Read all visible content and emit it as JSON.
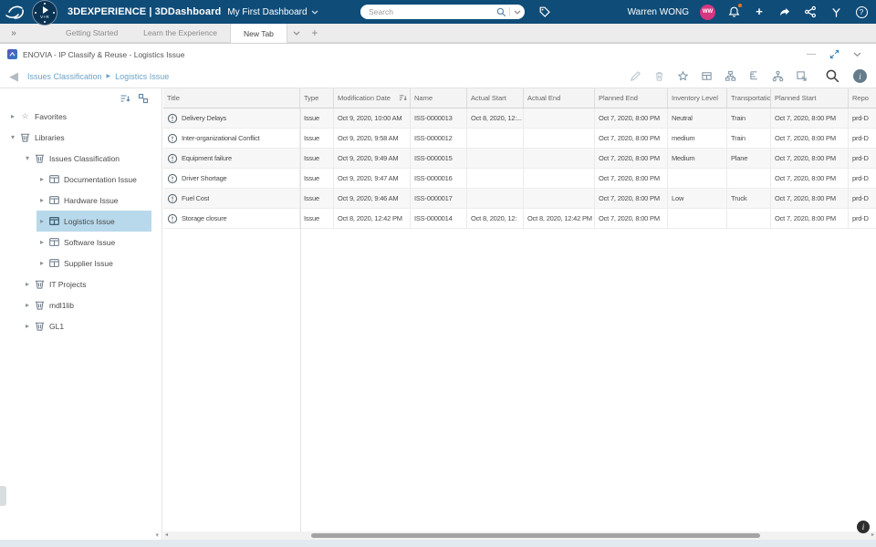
{
  "topbar": {
    "brand_bold": "3DEXPERIENCE | 3DDashboard",
    "dashboard_title": "My First Dashboard",
    "compass_label": "V+R",
    "search_placeholder": "Search",
    "user_name": "Warren WONG",
    "avatar_initials": "WW"
  },
  "tabbar": {
    "tabs": [
      {
        "label": "Getting Started",
        "active": false
      },
      {
        "label": "Learn the Experience",
        "active": false
      },
      {
        "label": "New Tab",
        "active": true
      }
    ]
  },
  "app": {
    "title": "ENOVIA - IP Classify & Reuse - Logistics Issue",
    "breadcrumb": [
      "Issues Classification",
      "Logistics Issue"
    ]
  },
  "sidebar": {
    "items": [
      {
        "label": "Favorites",
        "icon": "star-icon",
        "level": 0,
        "state": "collapsed",
        "selected": false
      },
      {
        "label": "Libraries",
        "icon": "library-icon",
        "level": 0,
        "state": "expanded",
        "selected": false
      },
      {
        "label": "Issues Classification",
        "icon": "library-icon",
        "level": 1,
        "state": "expanded",
        "selected": false
      },
      {
        "label": "Documentation Issue",
        "icon": "class-icon",
        "level": 2,
        "state": "collapsed",
        "selected": false
      },
      {
        "label": "Hardware Issue",
        "icon": "class-icon",
        "level": 2,
        "state": "collapsed",
        "selected": false
      },
      {
        "label": "Logistics Issue",
        "icon": "class-icon",
        "level": 2,
        "state": "collapsed",
        "selected": true
      },
      {
        "label": "Software Issue",
        "icon": "class-icon",
        "level": 2,
        "state": "collapsed",
        "selected": false
      },
      {
        "label": "Supplier Issue",
        "icon": "class-icon",
        "level": 2,
        "state": "collapsed",
        "selected": false
      },
      {
        "label": "IT Projects",
        "icon": "library-icon",
        "level": 1,
        "state": "collapsed",
        "selected": false
      },
      {
        "label": "mdl1lib",
        "icon": "library-icon",
        "level": 1,
        "state": "collapsed",
        "selected": false
      },
      {
        "label": "GL1",
        "icon": "library-icon",
        "level": 1,
        "state": "collapsed",
        "selected": false
      }
    ]
  },
  "table": {
    "columns": [
      "Title",
      "Type",
      "Modification Date",
      "Name",
      "Actual Start",
      "Actual End",
      "Planned End",
      "Inventory Level",
      "Transportation...",
      "Planned Start",
      "Repo"
    ],
    "sorted_column": "Modification Date",
    "rows": [
      {
        "cells": [
          "Delivery Delays",
          "Issue",
          "Oct 9, 2020, 10:00 AM",
          "ISS-0000013",
          "Oct 8, 2020, 12:...",
          "",
          "Oct 7, 2020, 8:00 PM",
          "Neutral",
          "Train",
          "Oct 7, 2020, 8:00 PM",
          "prd-D"
        ]
      },
      {
        "cells": [
          "Inter-organizational Conflict",
          "Issue",
          "Oct 9, 2020, 9:58 AM",
          "ISS-0000012",
          "",
          "",
          "Oct 7, 2020, 8:00 PM",
          "medium",
          "Train",
          "Oct 7, 2020, 8:00 PM",
          "prd-D"
        ]
      },
      {
        "cells": [
          "Equipment failure",
          "Issue",
          "Oct 9, 2020, 9:49 AM",
          "ISS-0000015",
          "",
          "",
          "Oct 7, 2020, 8:00 PM",
          "Medium",
          "Plane",
          "Oct 7, 2020, 8:00 PM",
          "prd-D"
        ]
      },
      {
        "cells": [
          "Driver Shortage",
          "Issue",
          "Oct 9, 2020, 9:47 AM",
          "ISS-0000016",
          "",
          "",
          "Oct 7, 2020, 8:00 PM",
          "",
          "",
          "Oct 7, 2020, 8:00 PM",
          "prd-D"
        ]
      },
      {
        "cells": [
          "Fuel Cost",
          "Issue",
          "Oct 9, 2020, 9:46 AM",
          "ISS-0000017",
          "",
          "",
          "Oct 7, 2020, 8:00 PM",
          "Low",
          "Truck",
          "Oct 7, 2020, 8:00 PM",
          "prd-D"
        ]
      },
      {
        "cells": [
          "Storage closure",
          "Issue",
          "Oct 8, 2020, 12:42 PM",
          "ISS-0000014",
          "Oct 8, 2020, 12:",
          "Oct 8, 2020, 12:42 PM",
          "Oct 7, 2020, 8:00 PM",
          "",
          "",
          "Oct 7, 2020, 8:00 PM",
          "prd-D"
        ]
      }
    ]
  },
  "icons": {
    "expand_collapsed": "▸",
    "expand_expanded": "▾",
    "back_arrow": "◀",
    "crumb_separator": "▶",
    "star_outline": "☆",
    "plus": "+",
    "minus": "—",
    "help": "?",
    "info": "i",
    "panel_toggle": "»",
    "scroll_left": "◂",
    "scroll_right": "▸",
    "scroll_down": "▾"
  },
  "colors": {
    "topbar_bg": "#0f4c78",
    "selected_item_bg": "#b8d9eb",
    "avatar_bg": "#d6367f",
    "notification_badge": "#e87722",
    "breadcrumb_text": "#6ba3c9",
    "maximize_icon": "#2f80bf"
  }
}
